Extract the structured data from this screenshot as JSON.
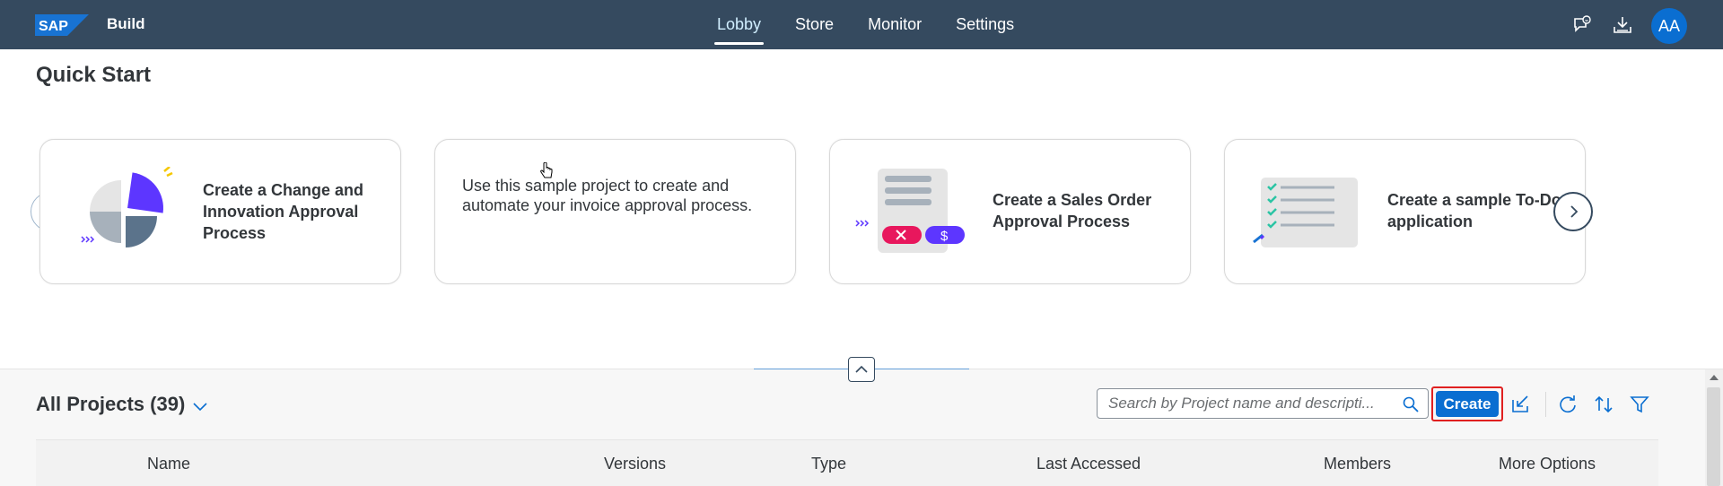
{
  "shell": {
    "logo_text": "SAP",
    "product": "Build",
    "nav": [
      "Lobby",
      "Store",
      "Monitor",
      "Settings"
    ],
    "active_nav": "Lobby",
    "avatar_initials": "AA"
  },
  "quick_start": {
    "title": "Quick Start",
    "cards": [
      {
        "title": "Create a Change and Innovation Approval Process",
        "icon": "process-chart-illustration"
      },
      {
        "description": "Use this sample project to create and automate your invoice approval process."
      },
      {
        "title": "Create a Sales Order Approval Process",
        "icon": "approval-illustration"
      },
      {
        "title": "Create a sample To-Do application",
        "icon": "checklist-illustration"
      }
    ]
  },
  "projects": {
    "title": "All Projects (39)",
    "search_placeholder": "Search by Project name and descripti...",
    "create_label": "Create",
    "columns": [
      "Name",
      "Versions",
      "Type",
      "Last Accessed",
      "Members",
      "More Options"
    ]
  },
  "colors": {
    "shell_bg": "#354a5f",
    "accent": "#0a6ed1",
    "create_highlight": "#e02020"
  }
}
